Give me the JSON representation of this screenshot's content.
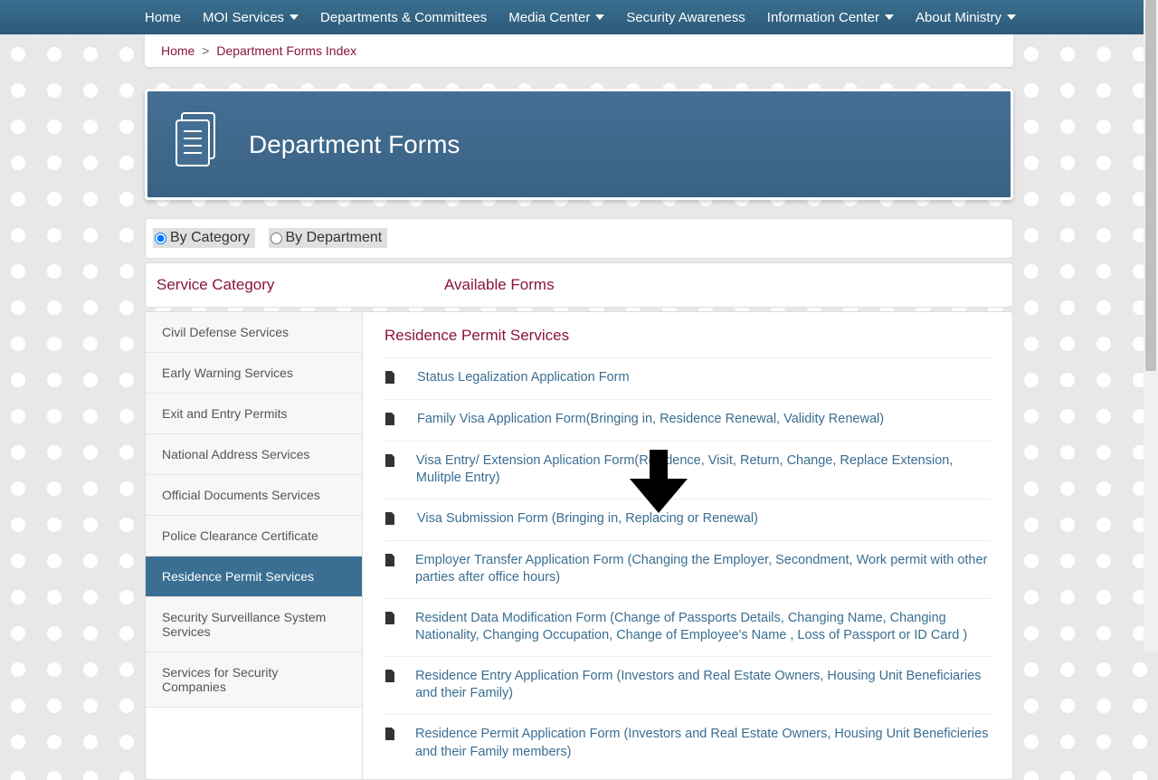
{
  "nav": {
    "items": [
      {
        "label": "Home",
        "dropdown": false
      },
      {
        "label": "MOI Services",
        "dropdown": true
      },
      {
        "label": "Departments & Committees",
        "dropdown": false
      },
      {
        "label": "Media Center",
        "dropdown": true
      },
      {
        "label": "Security Awareness",
        "dropdown": false
      },
      {
        "label": "Information Center",
        "dropdown": true
      },
      {
        "label": "About Ministry",
        "dropdown": true
      }
    ]
  },
  "breadcrumb": {
    "home": "Home",
    "sep": ">",
    "current": "Department Forms Index"
  },
  "hero": {
    "title": "Department Forms"
  },
  "filter": {
    "by_category": "By Category",
    "by_department": "By Department",
    "selected": "category"
  },
  "headers": {
    "left": "Service Category",
    "right": "Available Forms"
  },
  "sidebar": {
    "items": [
      "Civil Defense Services",
      "Early Warning Services",
      "Exit and Entry Permits",
      "National Address Services",
      "Official Documents Services",
      "Police Clearance Certificate",
      "Residence Permit Services",
      "Security Surveillance System Services",
      "Services for Security Companies"
    ],
    "active_index": 6
  },
  "forms": {
    "title": "Residence Permit Services",
    "items": [
      "Status Legalization Application Form",
      "Family Visa Application Form(Bringing in, Residence Renewal, Validity Renewal)",
      "Visa Entry/ Extension Aplication Form(Residence, Visit, Return, Change, Replace Extension, Mulitple Entry)",
      "Visa Submission Form (Bringing in, Replacing or Renewal)",
      "Employer Transfer Application Form (Changing the Employer, Secondment, Work permit with other parties after office hours)",
      "Resident Data Modification Form (Change of Passports Details, Changing Name, Changing Nationality, Changing Occupation, Change of Employee's Name , Loss of Passport or ID Card )",
      "Residence Entry Application Form (Investors and Real Estate Owners, Housing Unit Beneficiaries and their Family)",
      "Residence Permit Application Form (Investors and Real Estate Owners, Housing Unit Beneficieries and their Family members)"
    ]
  }
}
